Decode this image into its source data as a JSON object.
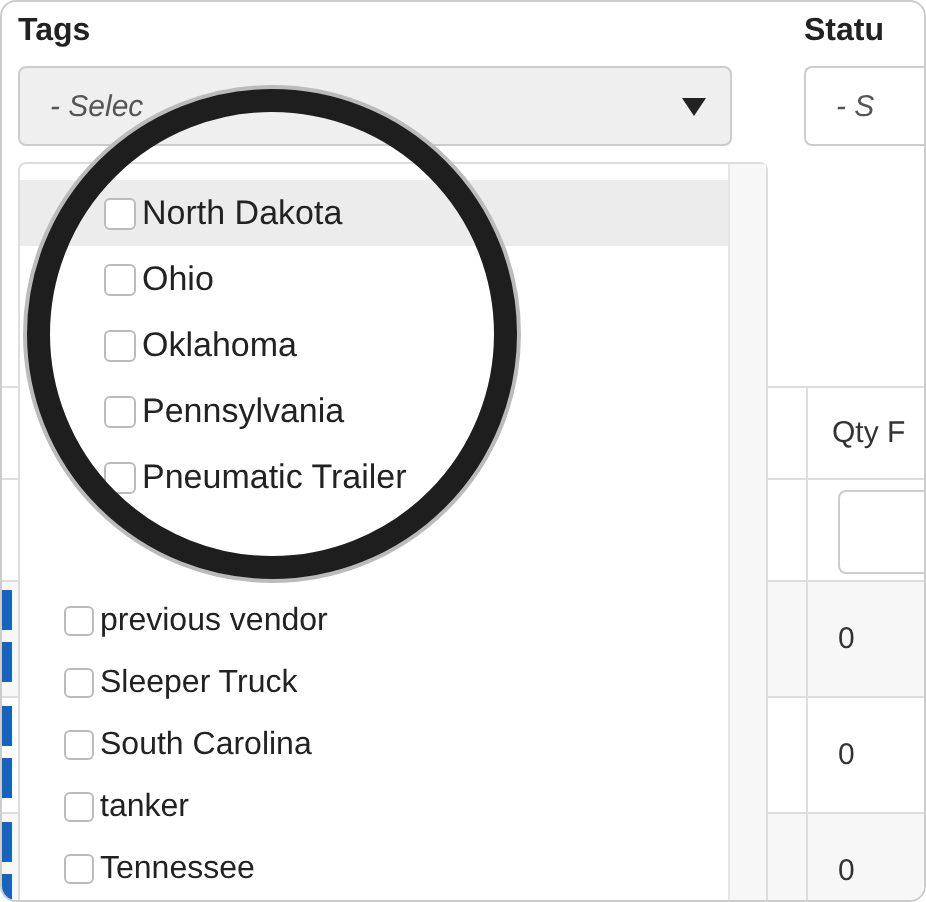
{
  "tags": {
    "label": "Tags",
    "placeholder": "- Selec",
    "options": [
      {
        "label": "North Dakota",
        "checked": false,
        "hovered": true,
        "kind": "magnified"
      },
      {
        "label": "Ohio",
        "checked": false,
        "hovered": false,
        "kind": "magnified"
      },
      {
        "label": "Oklahoma",
        "checked": false,
        "hovered": false,
        "kind": "magnified"
      },
      {
        "label": "Pennsylvania",
        "checked": false,
        "hovered": false,
        "kind": "magnified"
      },
      {
        "label": "Pneumatic Trailer",
        "checked": false,
        "hovered": false,
        "kind": "magnified"
      },
      {
        "label": "previous vendor",
        "checked": false,
        "hovered": false,
        "kind": "plain"
      },
      {
        "label": "Sleeper Truck",
        "checked": false,
        "hovered": false,
        "kind": "plain"
      },
      {
        "label": "South Carolina",
        "checked": false,
        "hovered": false,
        "kind": "plain"
      },
      {
        "label": "tanker",
        "checked": false,
        "hovered": false,
        "kind": "plain"
      },
      {
        "label": "Tennessee",
        "checked": false,
        "hovered": false,
        "kind": "plain"
      }
    ]
  },
  "status": {
    "label": "Statu",
    "placeholder": "- S"
  },
  "table": {
    "header": "Qty F",
    "rows": [
      "0",
      "0",
      "0"
    ]
  }
}
